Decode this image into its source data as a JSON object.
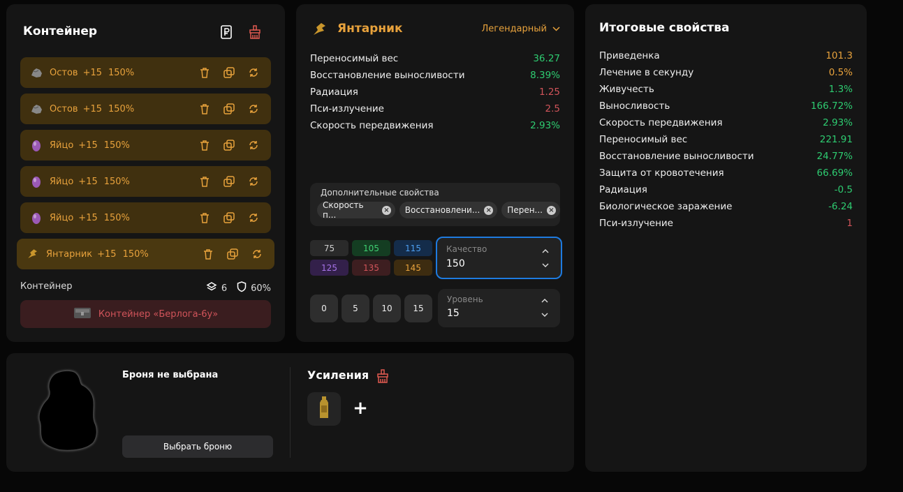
{
  "container": {
    "title": "Контейнер",
    "rows": [
      {
        "name": "Остов",
        "plus": "+15",
        "quality": "150%",
        "icon": "rock-artifact-icon"
      },
      {
        "name": "Остов",
        "plus": "+15",
        "quality": "150%",
        "icon": "rock-artifact-icon"
      },
      {
        "name": "Яйцо",
        "plus": "+15",
        "quality": "150%",
        "icon": "egg-artifact-icon"
      },
      {
        "name": "Яйцо",
        "plus": "+15",
        "quality": "150%",
        "icon": "egg-artifact-icon"
      },
      {
        "name": "Яйцо",
        "plus": "+15",
        "quality": "150%",
        "icon": "egg-artifact-icon"
      },
      {
        "name": "Янтарник",
        "plus": "+15",
        "quality": "150%",
        "icon": "amber-artifact-icon"
      }
    ],
    "footer_label": "Контейнер",
    "slots": "6",
    "protection": "60%",
    "container_button": "Контейнер «Берлога-6у»"
  },
  "artifact": {
    "name": "Янтарник",
    "rarity": "Легендарный",
    "stats": [
      {
        "label": "Переносимый вес",
        "value": "36.27",
        "color": "green"
      },
      {
        "label": "Восстановление выносливости",
        "value": "8.39%",
        "color": "green"
      },
      {
        "label": "Радиация",
        "value": "1.25",
        "color": "red"
      },
      {
        "label": "Пси-излучение",
        "value": "2.5",
        "color": "red"
      },
      {
        "label": "Скорость передвижения",
        "value": "2.93%",
        "color": "green"
      }
    ],
    "additional_label": "Дополнительные свойства",
    "chips": [
      "Скорость п...",
      "Восстановлени...",
      "Перен..."
    ],
    "quality_presets": [
      {
        "value": "75",
        "bg": "#2a2a2a",
        "fg": "#cfcfcf"
      },
      {
        "value": "105",
        "bg": "#143d22",
        "fg": "#3fcf72"
      },
      {
        "value": "115",
        "bg": "#142c4a",
        "fg": "#4d9ef0"
      },
      {
        "value": "125",
        "bg": "#33204a",
        "fg": "#a774e8"
      },
      {
        "value": "135",
        "bg": "#3d1e20",
        "fg": "#d1545a"
      },
      {
        "value": "145",
        "bg": "#3d2c10",
        "fg": "#e8a23c"
      }
    ],
    "quality_label": "Качество",
    "quality_value": "150",
    "level_presets": [
      "0",
      "5",
      "10",
      "15"
    ],
    "level_label": "Уровень",
    "level_value": "15"
  },
  "totals": {
    "title": "Итоговые свойства",
    "stats": [
      {
        "label": "Приведенка",
        "value": "101.3",
        "color": "orange"
      },
      {
        "label": "Лечение в секунду",
        "value": "0.5%",
        "color": "orange"
      },
      {
        "label": "Живучесть",
        "value": "1.3%",
        "color": "green"
      },
      {
        "label": "Выносливость",
        "value": "166.72%",
        "color": "green"
      },
      {
        "label": "Скорость передвижения",
        "value": "2.93%",
        "color": "green"
      },
      {
        "label": "Переносимый вес",
        "value": "221.91",
        "color": "green"
      },
      {
        "label": "Восстановление выносливости",
        "value": "24.77%",
        "color": "green"
      },
      {
        "label": "Защита от кровотечения",
        "value": "66.69%",
        "color": "green"
      },
      {
        "label": "Радиация",
        "value": "-0.5",
        "color": "green"
      },
      {
        "label": "Биологическое заражение",
        "value": "-6.24",
        "color": "green"
      },
      {
        "label": "Пси-излучение",
        "value": "1",
        "color": "red"
      }
    ]
  },
  "armor": {
    "title": "Броня не выбрана",
    "select_button": "Выбрать броню",
    "boosts_title": "Усиления",
    "add_symbol": "+"
  }
}
